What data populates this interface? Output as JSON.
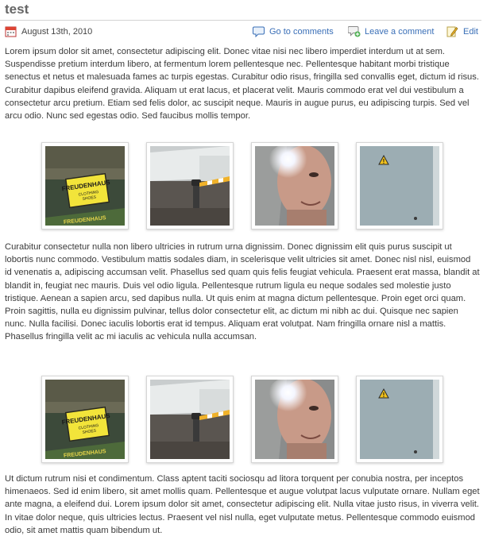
{
  "post": {
    "title": "test",
    "date": "August 13th, 2010",
    "goto_comments": "Go to comments",
    "leave_comment": "Leave a comment",
    "edit": "Edit"
  },
  "paragraphs": [
    "Lorem ipsum dolor sit amet, consectetur adipiscing elit. Donec vitae nisi nec libero imperdiet interdum ut at sem. Suspendisse pretium interdum libero, at fermentum lorem pellentesque nec. Pellentesque habitant morbi tristique senectus et netus et malesuada fames ac turpis egestas. Curabitur odio risus, fringilla sed convallis eget, dictum id risus. Curabitur dapibus eleifend gravida. Aliquam ut erat lacus, et placerat velit. Mauris commodo erat vel dui vestibulum a consectetur arcu pretium. Etiam sed felis dolor, ac suscipit neque. Mauris in augue purus, eu adipiscing turpis. Sed vel arcu odio. Nunc sed egestas odio. Sed faucibus mollis tempor.",
    "Curabitur consectetur nulla non libero ultricies in rutrum urna dignissim. Donec dignissim elit quis purus suscipit ut lobortis nunc commodo. Vestibulum mattis sodales diam, in scelerisque velit ultricies sit amet. Donec nisl nisl, euismod id venenatis a, adipiscing accumsan velit. Phasellus sed quam quis felis feugiat vehicula. Praesent erat massa, blandit at blandit in, feugiat nec mauris. Duis vel odio ligula. Pellentesque rutrum ligula eu neque sodales sed molestie justo tristique. Aenean a sapien arcu, sed dapibus nulla. Ut quis enim at magna dictum pellentesque. Proin eget orci quam. Proin sagittis, nulla eu dignissim pulvinar, tellus dolor consectetur elit, ac dictum mi nibh ac dui. Quisque nec sapien nunc. Nulla facilisi. Donec iaculis lobortis erat id tempus. Aliquam erat volutpat. Nam fringilla ornare nisl a mattis. Phasellus fringilla velit ac mi iaculis ac vehicula nulla accumsan.",
    "Ut dictum rutrum nisi et condimentum. Class aptent taciti sociosqu ad litora torquent per conubia nostra, per inceptos himenaeos. Sed id enim libero, sit amet mollis quam. Pellentesque et augue volutpat lacus vulputate ornare. Nullam eget ante magna, a eleifend dui. Lorem ipsum dolor sit amet, consectetur adipiscing elit. Nulla vitae justo risus, in viverra velit. In vitae dolor neque, quis ultricies lectus. Praesent vel nisl nulla, eget vulputate metus. Pellentesque commodo euismod odio, sit amet mattis quam bibendum ut."
  ],
  "gallery_sign_text": {
    "line1": "FREUDENHAUS",
    "line2": "CLOTHING",
    "line3": "SHOES",
    "footer": "FREUDENHAUS"
  },
  "icons": {
    "date": "calendar-icon",
    "comments": "speech-bubble-icon",
    "leave": "add-comment-icon",
    "edit": "pencil-icon"
  },
  "colors": {
    "link": "#3a6fb7",
    "title": "#666666",
    "text": "#3a3a3a"
  }
}
